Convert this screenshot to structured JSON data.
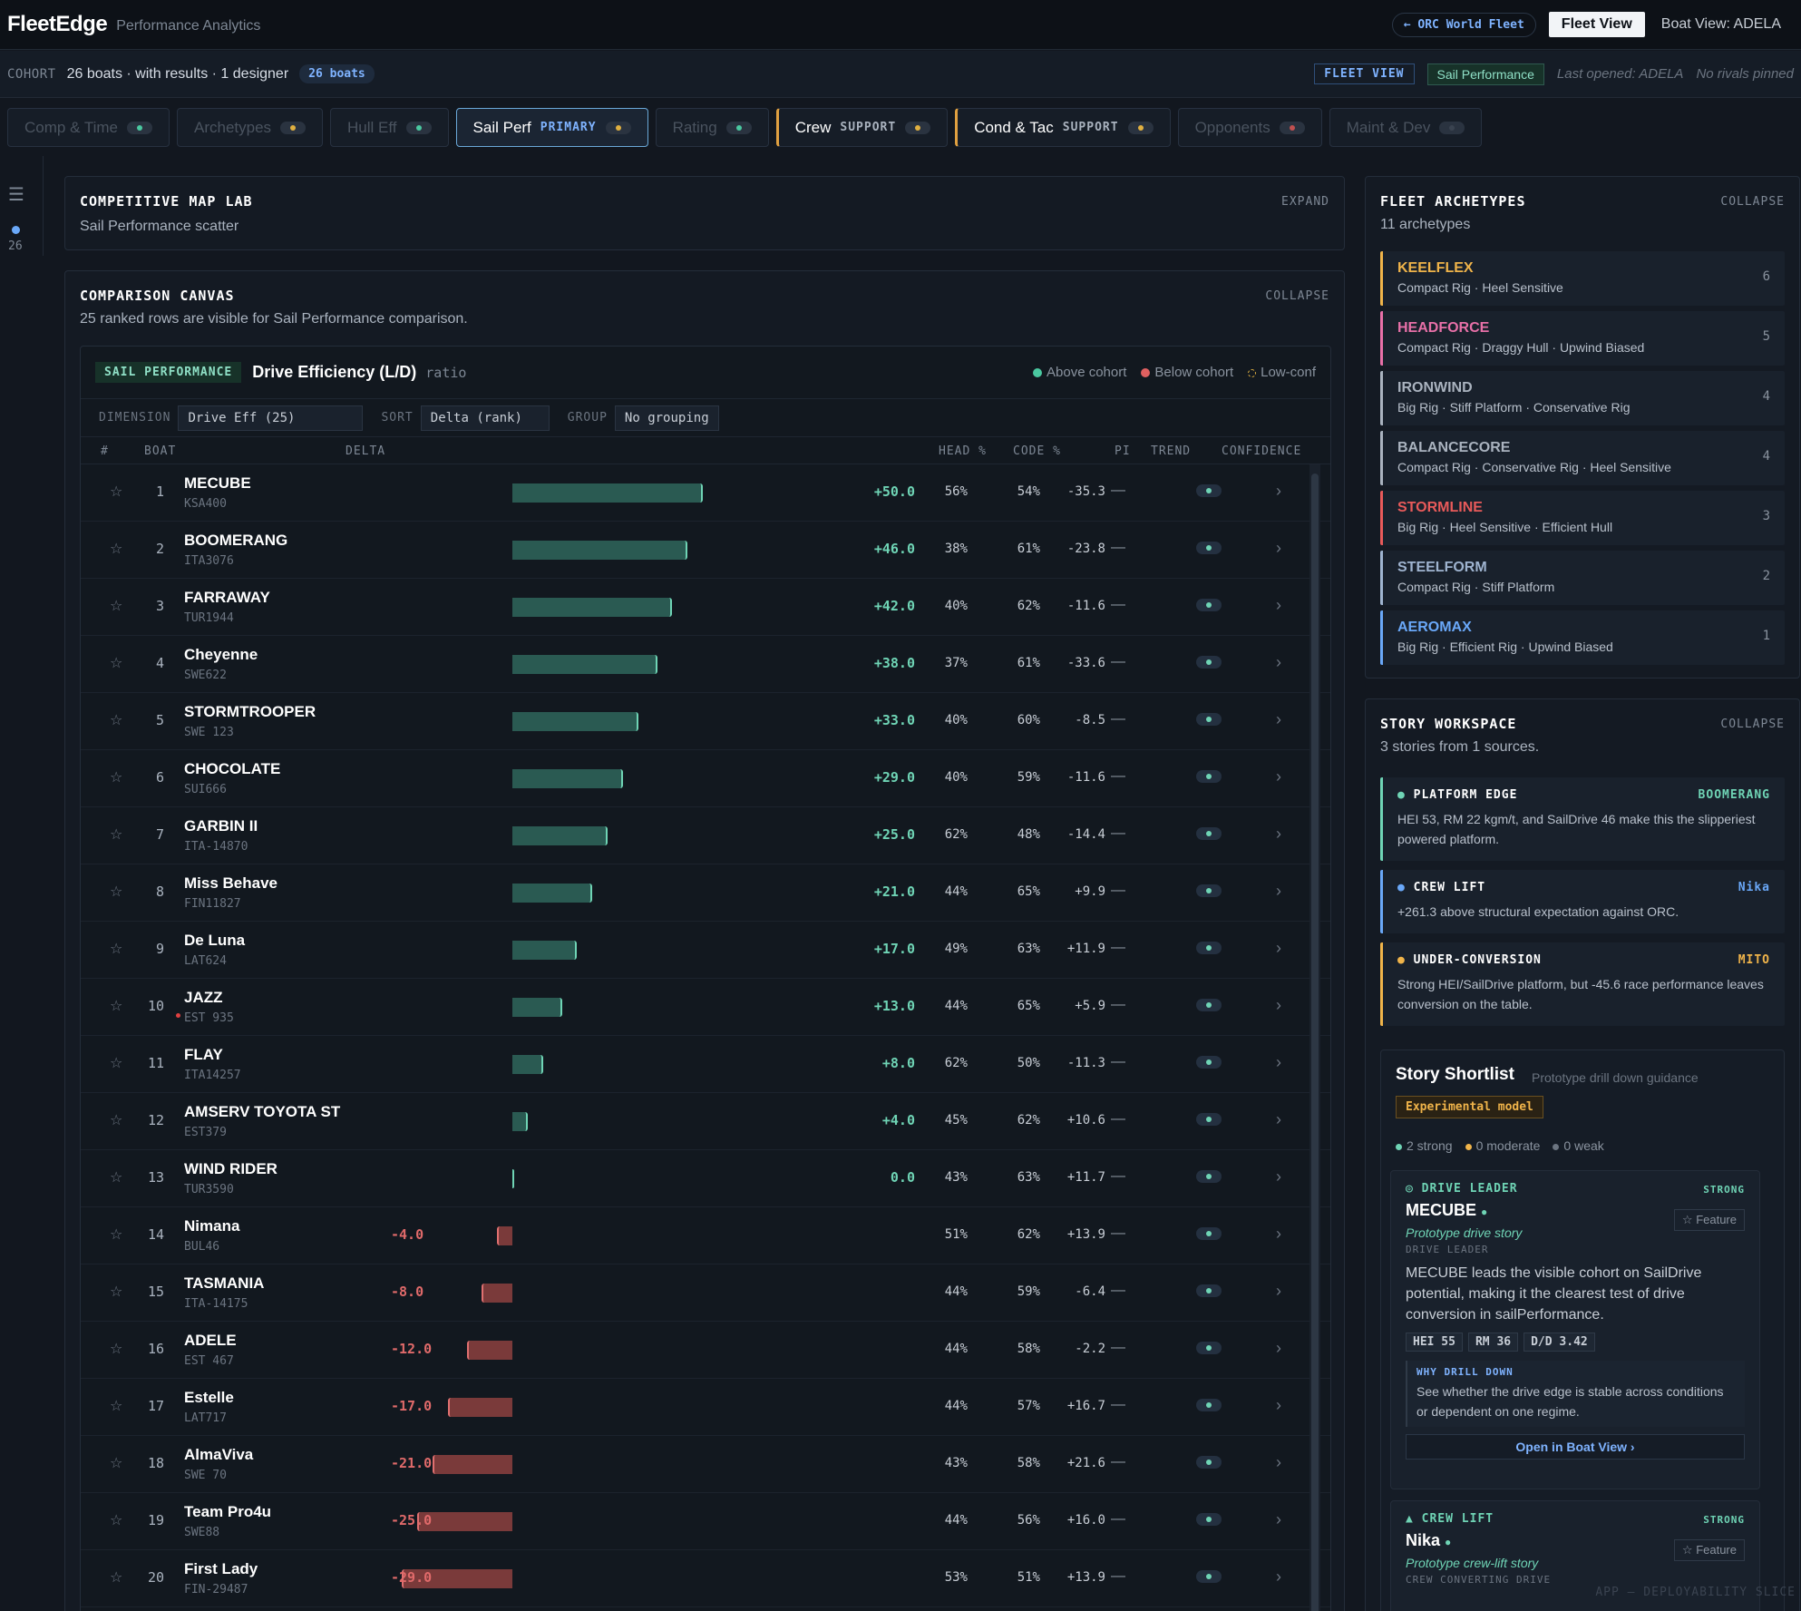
{
  "header": {
    "logo": "FleetEdge",
    "subtitle": "Performance Analytics",
    "orc_button": "← ORC World Fleet",
    "fleet_view": "Fleet View",
    "boat_view": "Boat View: ADELA"
  },
  "cohort": {
    "label": "COHORT",
    "text": "26 boats · with results · 1 designer",
    "badge": "26 boats",
    "fleet_view_badge": "FLEET VIEW",
    "sail_perf_badge": "Sail Performance",
    "last_opened": "Last opened: ADELA",
    "rivals": "No rivals pinned"
  },
  "tabs": [
    {
      "label": "Comp & Time",
      "role": "",
      "state": "dim",
      "dot": "#4ac8a0"
    },
    {
      "label": "Archetypes",
      "role": "",
      "state": "dim",
      "dot": "#e0b040"
    },
    {
      "label": "Hull Eff",
      "role": "",
      "state": "dim",
      "dot": "#4ac8a0"
    },
    {
      "label": "Sail Perf",
      "role": "PRIMARY",
      "state": "primary",
      "dot": "#e0b040"
    },
    {
      "label": "Rating",
      "role": "",
      "state": "dim",
      "dot": "#4ac8a0"
    },
    {
      "label": "Crew",
      "role": "SUPPORT",
      "state": "support",
      "dot": "#e0b040"
    },
    {
      "label": "Cond & Tac",
      "role": "SUPPORT",
      "state": "support",
      "dot": "#e0b040"
    },
    {
      "label": "Opponents",
      "role": "",
      "state": "dim",
      "dot": "#c05050"
    },
    {
      "label": "Maint & Dev",
      "role": "",
      "state": "dim",
      "dot": "#3a4350"
    }
  ],
  "rail": {
    "count": "26"
  },
  "map_lab": {
    "title": "COMPETITIVE MAP LAB",
    "subtitle": "Sail Performance scatter",
    "action": "EXPAND"
  },
  "canvas": {
    "title": "COMPARISON CANVAS",
    "subtitle": "25 ranked rows are visible for Sail Performance comparison.",
    "action": "COLLAPSE",
    "metric_badge": "SAIL PERFORMANCE",
    "metric_name": "Drive Efficiency (L/D)",
    "metric_unit": "ratio",
    "legend": {
      "above": "Above cohort",
      "below": "Below cohort",
      "lowconf": "Low-conf"
    },
    "controls": {
      "dimension_label": "DIMENSION",
      "dimension_value": "Drive Eff (25)",
      "sort_label": "SORT",
      "sort_value": "Delta (rank)",
      "group_label": "GROUP",
      "group_value": "No grouping"
    },
    "columns": {
      "num": "#",
      "boat": "BOAT",
      "delta": "DELTA",
      "head": "HEAD %",
      "code": "CODE %",
      "pi": "PI",
      "trend": "TREND",
      "confidence": "CONFIDENCE"
    },
    "rows": [
      {
        "rank": "1",
        "name": "MECUBE",
        "sail": "KSA400",
        "delta": 50.0,
        "delta_text": "+50.0",
        "head": "56%",
        "code": "54%",
        "pi": "-35.3",
        "conf": "—",
        "flag": false
      },
      {
        "rank": "2",
        "name": "BOOMERANG",
        "sail": "ITA3076",
        "delta": 46.0,
        "delta_text": "+46.0",
        "head": "38%",
        "code": "61%",
        "pi": "-23.8",
        "conf": "—",
        "flag": false
      },
      {
        "rank": "3",
        "name": "FARRAWAY",
        "sail": "TUR1944",
        "delta": 42.0,
        "delta_text": "+42.0",
        "head": "40%",
        "code": "62%",
        "pi": "-11.6",
        "conf": "—",
        "flag": false
      },
      {
        "rank": "4",
        "name": "Cheyenne",
        "sail": "SWE622",
        "delta": 38.0,
        "delta_text": "+38.0",
        "head": "37%",
        "code": "61%",
        "pi": "-33.6",
        "conf": "—",
        "flag": false
      },
      {
        "rank": "5",
        "name": "STORMTROOPER",
        "sail": "SWE 123",
        "delta": 33.0,
        "delta_text": "+33.0",
        "head": "40%",
        "code": "60%",
        "pi": "-8.5",
        "conf": "—",
        "flag": false
      },
      {
        "rank": "6",
        "name": "CHOCOLATE",
        "sail": "SUI666",
        "delta": 29.0,
        "delta_text": "+29.0",
        "head": "40%",
        "code": "59%",
        "pi": "-11.6",
        "conf": "—",
        "flag": false
      },
      {
        "rank": "7",
        "name": "GARBIN II",
        "sail": "ITA-14870",
        "delta": 25.0,
        "delta_text": "+25.0",
        "head": "62%",
        "code": "48%",
        "pi": "-14.4",
        "conf": "—",
        "flag": false
      },
      {
        "rank": "8",
        "name": "Miss Behave",
        "sail": "FIN11827",
        "delta": 21.0,
        "delta_text": "+21.0",
        "head": "44%",
        "code": "65%",
        "pi": "+9.9",
        "conf": "—",
        "flag": false
      },
      {
        "rank": "9",
        "name": "De Luna",
        "sail": "LAT624",
        "delta": 17.0,
        "delta_text": "+17.0",
        "head": "49%",
        "code": "63%",
        "pi": "+11.9",
        "conf": "—",
        "flag": false
      },
      {
        "rank": "10",
        "name": "JAZZ",
        "sail": "EST 935",
        "delta": 13.0,
        "delta_text": "+13.0",
        "head": "44%",
        "code": "65%",
        "pi": "+5.9",
        "conf": "—",
        "flag": true
      },
      {
        "rank": "11",
        "name": "FLAY",
        "sail": "ITA14257",
        "delta": 8.0,
        "delta_text": "+8.0",
        "head": "62%",
        "code": "50%",
        "pi": "-11.3",
        "conf": "—",
        "flag": false
      },
      {
        "rank": "12",
        "name": "AMSERV TOYOTA ST",
        "sail": "EST379",
        "delta": 4.0,
        "delta_text": "+4.0",
        "head": "45%",
        "code": "62%",
        "pi": "+10.6",
        "conf": "—",
        "flag": false
      },
      {
        "rank": "13",
        "name": "WIND RIDER",
        "sail": "TUR3590",
        "delta": 0.0,
        "delta_text": "0.0",
        "head": "43%",
        "code": "63%",
        "pi": "+11.7",
        "conf": "—",
        "flag": false
      },
      {
        "rank": "14",
        "name": "Nimana",
        "sail": "BUL46",
        "delta": -4.0,
        "delta_text": "-4.0",
        "head": "51%",
        "code": "62%",
        "pi": "+13.9",
        "conf": "—",
        "flag": false
      },
      {
        "rank": "15",
        "name": "TASMANIA",
        "sail": "ITA-14175",
        "delta": -8.0,
        "delta_text": "-8.0",
        "head": "44%",
        "code": "59%",
        "pi": "-6.4",
        "conf": "—",
        "flag": false
      },
      {
        "rank": "16",
        "name": "ADELE",
        "sail": "EST 467",
        "delta": -12.0,
        "delta_text": "-12.0",
        "head": "44%",
        "code": "58%",
        "pi": "-2.2",
        "conf": "—",
        "flag": false
      },
      {
        "rank": "17",
        "name": "Estelle",
        "sail": "LAT717",
        "delta": -17.0,
        "delta_text": "-17.0",
        "head": "44%",
        "code": "57%",
        "pi": "+16.7",
        "conf": "—",
        "flag": false
      },
      {
        "rank": "18",
        "name": "AlmaViva",
        "sail": "SWE 70",
        "delta": -21.0,
        "delta_text": "-21.0",
        "head": "43%",
        "code": "58%",
        "pi": "+21.6",
        "conf": "—",
        "flag": false
      },
      {
        "rank": "19",
        "name": "Team Pro4u",
        "sail": "SWE88",
        "delta": -25.0,
        "delta_text": "-25.0",
        "head": "44%",
        "code": "56%",
        "pi": "+16.0",
        "conf": "—",
        "flag": false
      },
      {
        "rank": "20",
        "name": "First Lady",
        "sail": "FIN-29487",
        "delta": -29.0,
        "delta_text": "-29.0",
        "head": "53%",
        "code": "51%",
        "pi": "+13.9",
        "conf": "—",
        "flag": false
      }
    ]
  },
  "archetypes": {
    "title": "FLEET ARCHETYPES",
    "subtitle": "11 archetypes",
    "action": "COLLAPSE",
    "items": [
      {
        "name": "KEELFLEX",
        "desc": "Compact Rig · Heel Sensitive",
        "count": "6",
        "color": "#f0b44a"
      },
      {
        "name": "HEADFORCE",
        "desc": "Compact Rig · Draggy Hull · Upwind Biased",
        "count": "5",
        "color": "#e870a8"
      },
      {
        "name": "IRONWIND",
        "desc": "Big Rig · Stiff Platform · Conservative Rig",
        "count": "4",
        "color": "#aab3bf"
      },
      {
        "name": "BALANCECORE",
        "desc": "Compact Rig · Conservative Rig · Heel Sensitive",
        "count": "4",
        "color": "#aab3bf"
      },
      {
        "name": "STORMLINE",
        "desc": "Big Rig · Heel Sensitive · Efficient Hull",
        "count": "3",
        "color": "#e85a5a"
      },
      {
        "name": "STEELFORM",
        "desc": "Compact Rig · Stiff Platform",
        "count": "2",
        "color": "#9fb4d0"
      },
      {
        "name": "AEROMAX",
        "desc": "Big Rig · Efficient Rig · Upwind Biased",
        "count": "1",
        "color": "#6aa8f8"
      }
    ]
  },
  "stories": {
    "title": "STORY WORKSPACE",
    "subtitle": "3 stories from 1 sources.",
    "action": "COLLAPSE",
    "items": [
      {
        "title": "PLATFORM EDGE",
        "boat": "BOOMERANG",
        "text": "HEI 53, RM 22 kgm/t, and SailDrive 46 make this the slipperiest powered platform.",
        "color": "#6fd4b5"
      },
      {
        "title": "CREW LIFT",
        "boat": "Nika",
        "text": "+261.3 above structural expectation against ORC.",
        "color": "#6aa8f8"
      },
      {
        "title": "UNDER-CONVERSION",
        "boat": "MITO",
        "text": "Strong HEI/SailDrive platform, but -45.6 race performance leaves conversion on the table.",
        "color": "#f0b44a"
      }
    ],
    "shortlist": {
      "title": "Story Shortlist",
      "subtitle": "Prototype drill  down guidance",
      "badge": "Experimental model",
      "strong": "2 strong",
      "moderate": "0 moderate",
      "weak": "0 weak",
      "cards": [
        {
          "kind": "◎ DRIVE LEADER",
          "strength": "STRONG",
          "boat": "MECUBE",
          "feature": "☆ Feature",
          "proto": "Prototype drive story",
          "label": "DRIVE LEADER",
          "text": "MECUBE leads the visible cohort on SailDrive potential, making it the clearest test of drive conversion in sailPerformance.",
          "chips": [
            "HEI 55",
            "RM 36",
            "D/D 3.42"
          ],
          "why_label": "WHY DRILL DOWN",
          "why_text": "See whether the drive edge is stable across conditions or dependent on one regime.",
          "open": "Open in Boat View ›"
        },
        {
          "kind": "▲ CREW LIFT",
          "strength": "STRONG",
          "boat": "Nika",
          "feature": "☆ Feature",
          "proto": "Prototype crew-lift story",
          "label": "CREW CONVERTING DRIVE"
        }
      ]
    }
  },
  "footer": "APP — DEPLOYABILITY SLICE"
}
